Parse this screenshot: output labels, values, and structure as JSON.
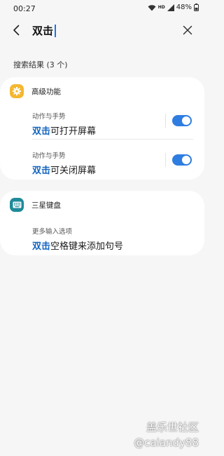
{
  "status_bar": {
    "time": "00:27",
    "battery": "48%",
    "hd_label": "HD",
    "icons": [
      "wifi-icon",
      "signal-icon",
      "battery-icon"
    ]
  },
  "search": {
    "query": "双击",
    "accent_color": "#1a73e8"
  },
  "results_header": "搜索结果 (3 个)",
  "groups": [
    {
      "title": "高级功能",
      "icon": "gear-icon",
      "icon_color": "#f5b731",
      "items": [
        {
          "category": "动作与手势",
          "highlight": "双击",
          "rest": "可打开屏幕",
          "toggle": true
        },
        {
          "category": "动作与手势",
          "highlight": "双击",
          "rest": "可关闭屏幕",
          "toggle": true
        }
      ]
    },
    {
      "title": "三星键盘",
      "icon": "keyboard-icon",
      "icon_color": "#1e8a9a",
      "items": [
        {
          "category": "更多输入选项",
          "highlight": "双击",
          "rest": "空格键来添加句号"
        }
      ]
    }
  ],
  "highlight_color": "#1565c0",
  "toggle_color": "#2f7de1",
  "watermark": {
    "line1": "盖乐世社区",
    "line2": "@caiandy88"
  }
}
